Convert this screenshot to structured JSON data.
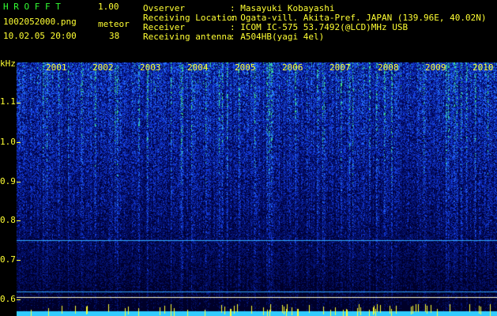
{
  "app": {
    "name": "H R O F F T",
    "version": "1.00"
  },
  "file": {
    "name": "1002052000.png",
    "datetime": "10.02.05 20:00"
  },
  "meteor": {
    "label": "meteor",
    "count": "38"
  },
  "info": {
    "observer_label": "Ovserver",
    "observer_value": ": Masayuki Kobayashi",
    "location_label": "Receiving Location",
    "location_value": ": Ogata-vill. Akita-Pref. JAPAN (139.96E, 40.02N)",
    "receiver_label": "Receiver",
    "receiver_value": ": ICOM IC-575 53.7492(@LCD)MHz USB",
    "antenna_label": "Receiving antenna",
    "antenna_value": ": A504HB(yagi 4el)"
  },
  "axis": {
    "unit": "kHz",
    "y_ticks": [
      "1.1",
      "1.0",
      "0.9",
      "0.8",
      "0.7",
      "0.6"
    ],
    "x_labels": [
      "2001",
      "2002",
      "2003",
      "2004",
      "2005",
      "2006",
      "2007",
      "2008",
      "2009",
      "2010"
    ]
  },
  "colors": {
    "background": "#000000",
    "text_yellow": "#ffff33",
    "title_green": "#33ff33",
    "signal_low": "#001a6e",
    "signal_mid": "#1f5cff",
    "signal_high": "#33ddaa",
    "baseline": "#33ccff"
  }
}
